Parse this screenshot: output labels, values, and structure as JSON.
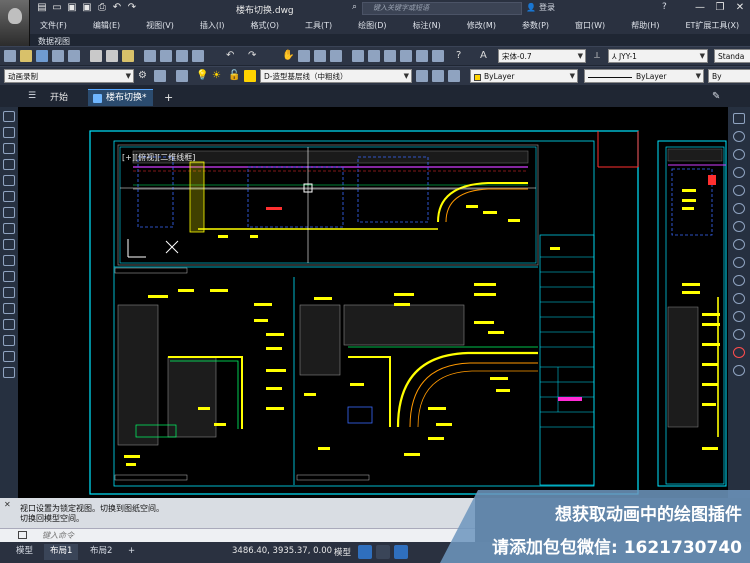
{
  "window": {
    "title": "楼布切换.dwg",
    "search_placeholder": "键入关键字或短语",
    "login_label": "登录",
    "help_label": "?"
  },
  "menubar": {
    "items": [
      "文件(F)",
      "编辑(E)",
      "视图(V)",
      "插入(I)",
      "格式(O)",
      "工具(T)",
      "绘图(D)",
      "标注(N)",
      "修改(M)",
      "参数(P)",
      "窗口(W)",
      "帮助(H)",
      "ET扩展工具(X)"
    ],
    "ribbon_tab": "数据视图"
  },
  "toolbar": {
    "font_select": "宋体-0.7",
    "dimstyle_select": "JYY-1",
    "textstyle_select": "Standa",
    "workspace_select": "动画录制",
    "layer_select": "D-造型基层线（中粗线）",
    "color_select": "ByLayer",
    "linetype_select": "ByLayer",
    "lineweight_select": "By"
  },
  "tabs": {
    "start": "开始",
    "active": "楼布切换*",
    "add": "+"
  },
  "canvas": {
    "viewport_label": "[+][俯视][二维线框]",
    "accent_colors": {
      "frame": "#00e5ff",
      "yellow": "#ffff00",
      "green": "#00ff66",
      "magenta": "#d23cff",
      "red": "#ff3030"
    }
  },
  "command": {
    "history": [
      "视口设置为锁定视图。切换到图纸空间。",
      "切换回模型空间。"
    ],
    "placeholder": "键入命令"
  },
  "statusbar": {
    "layout_tabs": [
      "模型",
      "布局1",
      "布局2"
    ],
    "active_layout": "布局1",
    "add_layout": "+",
    "coordinates": "3486.40, 3935.37, 0.00",
    "space_label": "模型"
  },
  "promo": {
    "line1": "想获取动画中的绘图插件",
    "line2": "请添加包包微信: 1621730740"
  }
}
